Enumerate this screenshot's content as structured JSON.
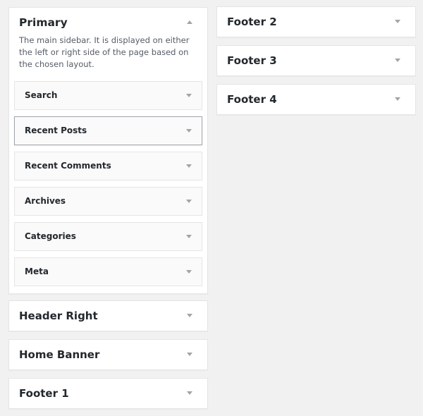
{
  "left_column": {
    "primary": {
      "title": "Primary",
      "description": "The main sidebar. It is displayed on either the left or right side of the page based on the chosen layout.",
      "expanded": true,
      "widgets": [
        {
          "label": "Search"
        },
        {
          "label": "Recent Posts"
        },
        {
          "label": "Recent Comments"
        },
        {
          "label": "Archives"
        },
        {
          "label": "Categories"
        },
        {
          "label": "Meta"
        }
      ]
    },
    "areas": [
      {
        "title": "Header Right"
      },
      {
        "title": "Home Banner"
      },
      {
        "title": "Footer 1"
      }
    ]
  },
  "right_column": {
    "areas": [
      {
        "title": "Footer 2"
      },
      {
        "title": "Footer 3"
      },
      {
        "title": "Footer 4"
      }
    ]
  },
  "icons": {
    "collapse": "triangle-up",
    "expand": "triangle-down"
  }
}
